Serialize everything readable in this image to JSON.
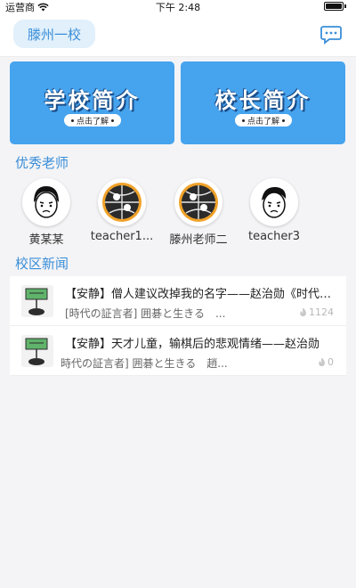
{
  "status_bar": {
    "carrier": "运营商",
    "time": "下午 2:48"
  },
  "nav": {
    "school_name": "滕州一校"
  },
  "banners": [
    {
      "title": "学校简介",
      "cta": "点击了解"
    },
    {
      "title": "校长简介",
      "cta": "点击了解"
    }
  ],
  "teachers_section": {
    "title": "优秀老师",
    "teachers": [
      {
        "name": "黄某某"
      },
      {
        "name": "teacher1..."
      },
      {
        "name": "滕州老师二"
      },
      {
        "name": "teacher3"
      }
    ]
  },
  "news_section": {
    "title": "校区新闻",
    "items": [
      {
        "headline": "【安静】僧人建议改掉我的名字——赵治勋《时代の証言者》",
        "summary": "[時代の証言者] 囲碁と生きる　...",
        "likes": "1124"
      },
      {
        "headline": "【安静】天才儿童，输棋后的悲观情绪——赵治勋",
        "summary": "時代の証言者] 囲碁と生きる　趙...",
        "likes": "0"
      }
    ]
  },
  "colors": {
    "accent": "#3a8ed8",
    "banner": "#46a3ee",
    "chip_bg": "#e1f0fb"
  }
}
